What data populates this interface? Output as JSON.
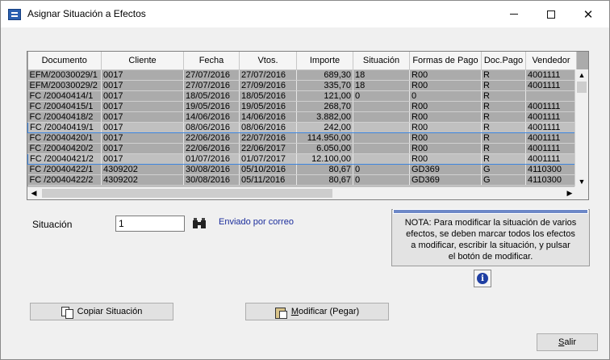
{
  "window": {
    "title": "Asignar Situación a Efectos"
  },
  "table": {
    "columns": [
      "Documento",
      "Cliente",
      "Fecha",
      "Vtos.",
      "Importe",
      "Situación",
      "Formas de Pago",
      "Doc.Pago",
      "Vendedor"
    ],
    "rows": [
      [
        "EFM/20030029/1",
        "0017",
        "27/07/2016",
        "27/07/2016",
        "689,30",
        "18",
        "R00",
        "R",
        "4001111"
      ],
      [
        "EFM/20030029/2",
        "0017",
        "27/07/2016",
        "27/09/2016",
        "335,70",
        "18",
        "R00",
        "R",
        "4001111"
      ],
      [
        "FC /20040414/1",
        "0017",
        "18/05/2016",
        "18/05/2016",
        "121,00",
        "0",
        "0",
        "R",
        ""
      ],
      [
        "FC /20040415/1",
        "0017",
        "19/05/2016",
        "19/05/2016",
        "268,70",
        "",
        "R00",
        "R",
        "4001111"
      ],
      [
        "FC /20040418/2",
        "0017",
        "14/06/2016",
        "14/06/2016",
        "3.882,00",
        "",
        "R00",
        "R",
        "4001111"
      ],
      [
        "FC /20040419/1",
        "0017",
        "08/06/2016",
        "08/06/2016",
        "242,00",
        "",
        "R00",
        "R",
        "4001111"
      ],
      [
        "FC /20040420/1",
        "0017",
        "22/06/2016",
        "22/07/2016",
        "114.950,00",
        "",
        "R00",
        "R",
        "4001111"
      ],
      [
        "FC /20040420/2",
        "0017",
        "22/06/2016",
        "22/06/2017",
        "6.050,00",
        "",
        "R00",
        "R",
        "4001111"
      ],
      [
        "FC /20040421/2",
        "0017",
        "01/07/2016",
        "01/07/2017",
        "12.100,00",
        "",
        "R00",
        "R",
        "4001111"
      ],
      [
        "FC /20040422/1",
        "4309202",
        "30/08/2016",
        "05/10/2016",
        "80,67",
        "0",
        "GD369",
        "G",
        "4110300"
      ],
      [
        "FC /20040422/2",
        "4309202",
        "30/08/2016",
        "05/11/2016",
        "80,67",
        "0",
        "GD369",
        "G",
        "4110300"
      ]
    ],
    "selected_rows": [
      5,
      8
    ]
  },
  "situacion": {
    "label": "Situación",
    "value": "1",
    "description": "Enviado por correo"
  },
  "note": {
    "lines": [
      "NOTA: Para modificar la situación de varios",
      "efectos, se deben marcar todos los efectos",
      "a modificar, escribir la situación, y pulsar",
      "el botón de modificar."
    ]
  },
  "buttons": {
    "copy": "Copiar Situación",
    "modify_underlined": "M",
    "modify_rest": "odificar (Pegar)",
    "exit_underlined": "S",
    "exit_rest": "alir"
  },
  "icons": {
    "binoculars": "binoculars-icon",
    "info": "info-icon",
    "copy": "copy-icon",
    "paste": "paste-icon"
  },
  "colors": {
    "grid_background": "#ababab",
    "selection_border": "#3d86e0",
    "description_text": "#1b2d9c",
    "info_icon": "#1f3fa3"
  }
}
